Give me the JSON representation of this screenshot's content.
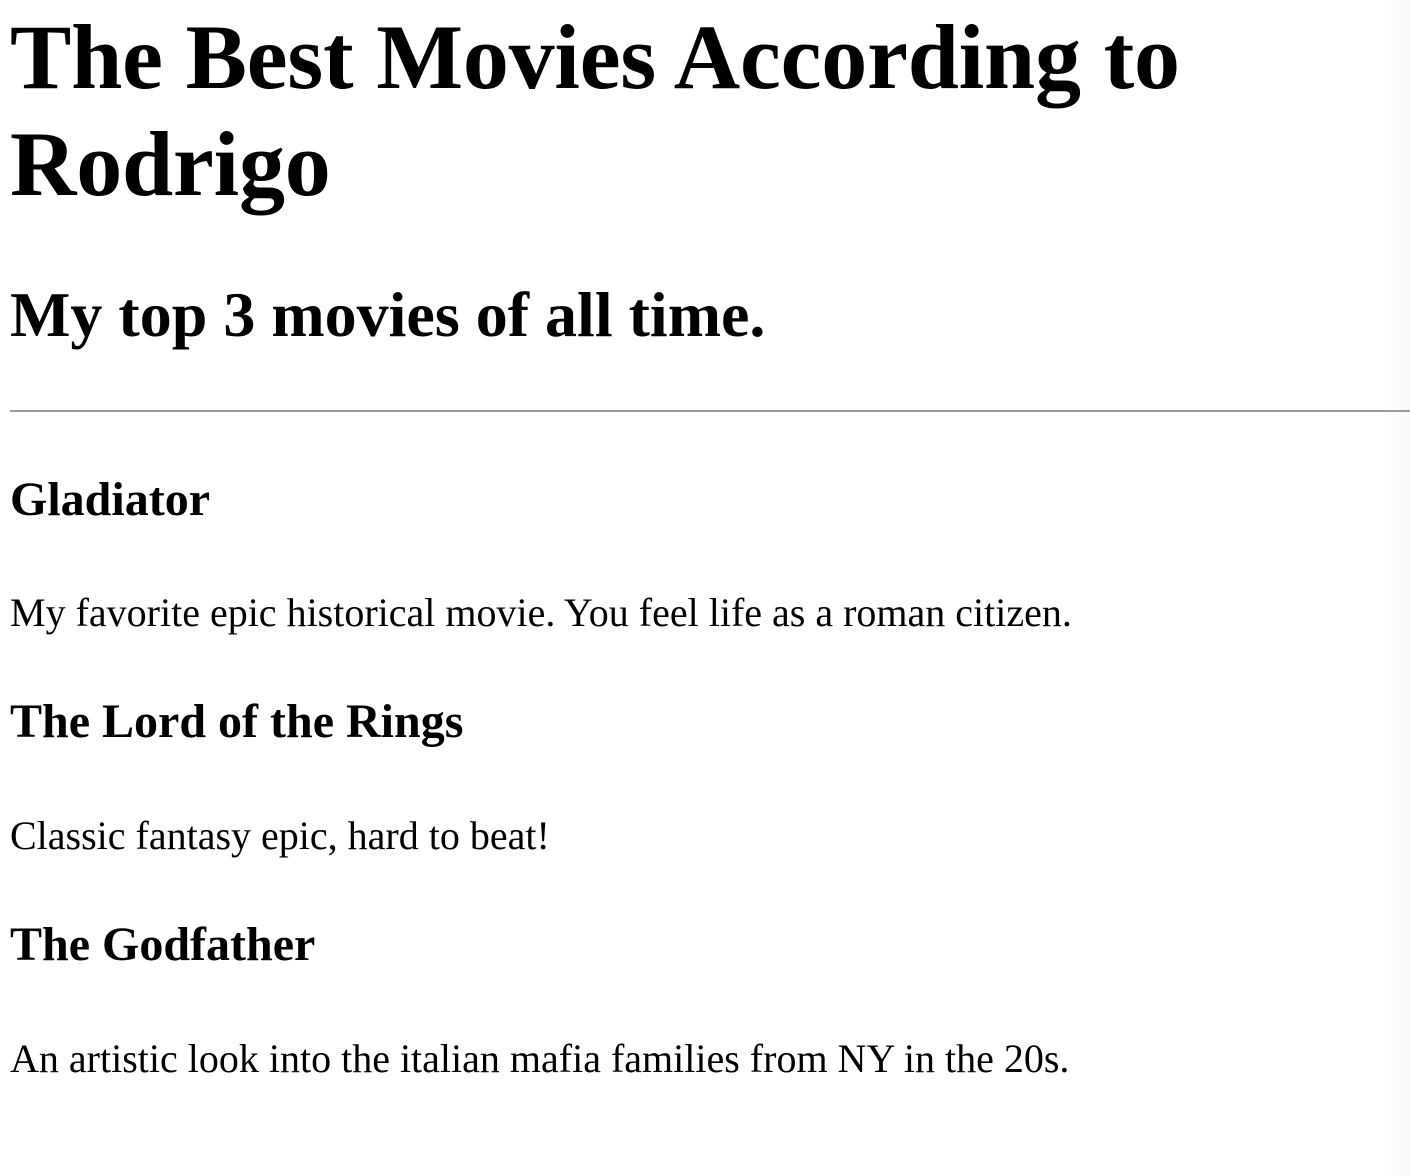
{
  "page": {
    "title": "The Best Movies According to Rodrigo",
    "subtitle": "My top 3 movies of all time."
  },
  "movies": [
    {
      "title": "Gladiator",
      "description": "My favorite epic historical movie. You feel life as a roman citizen."
    },
    {
      "title": "The Lord of the Rings",
      "description": "Classic fantasy epic, hard to beat!"
    },
    {
      "title": "The Godfather",
      "description": "An artistic look into the italian mafia families from NY in the 20s."
    }
  ]
}
